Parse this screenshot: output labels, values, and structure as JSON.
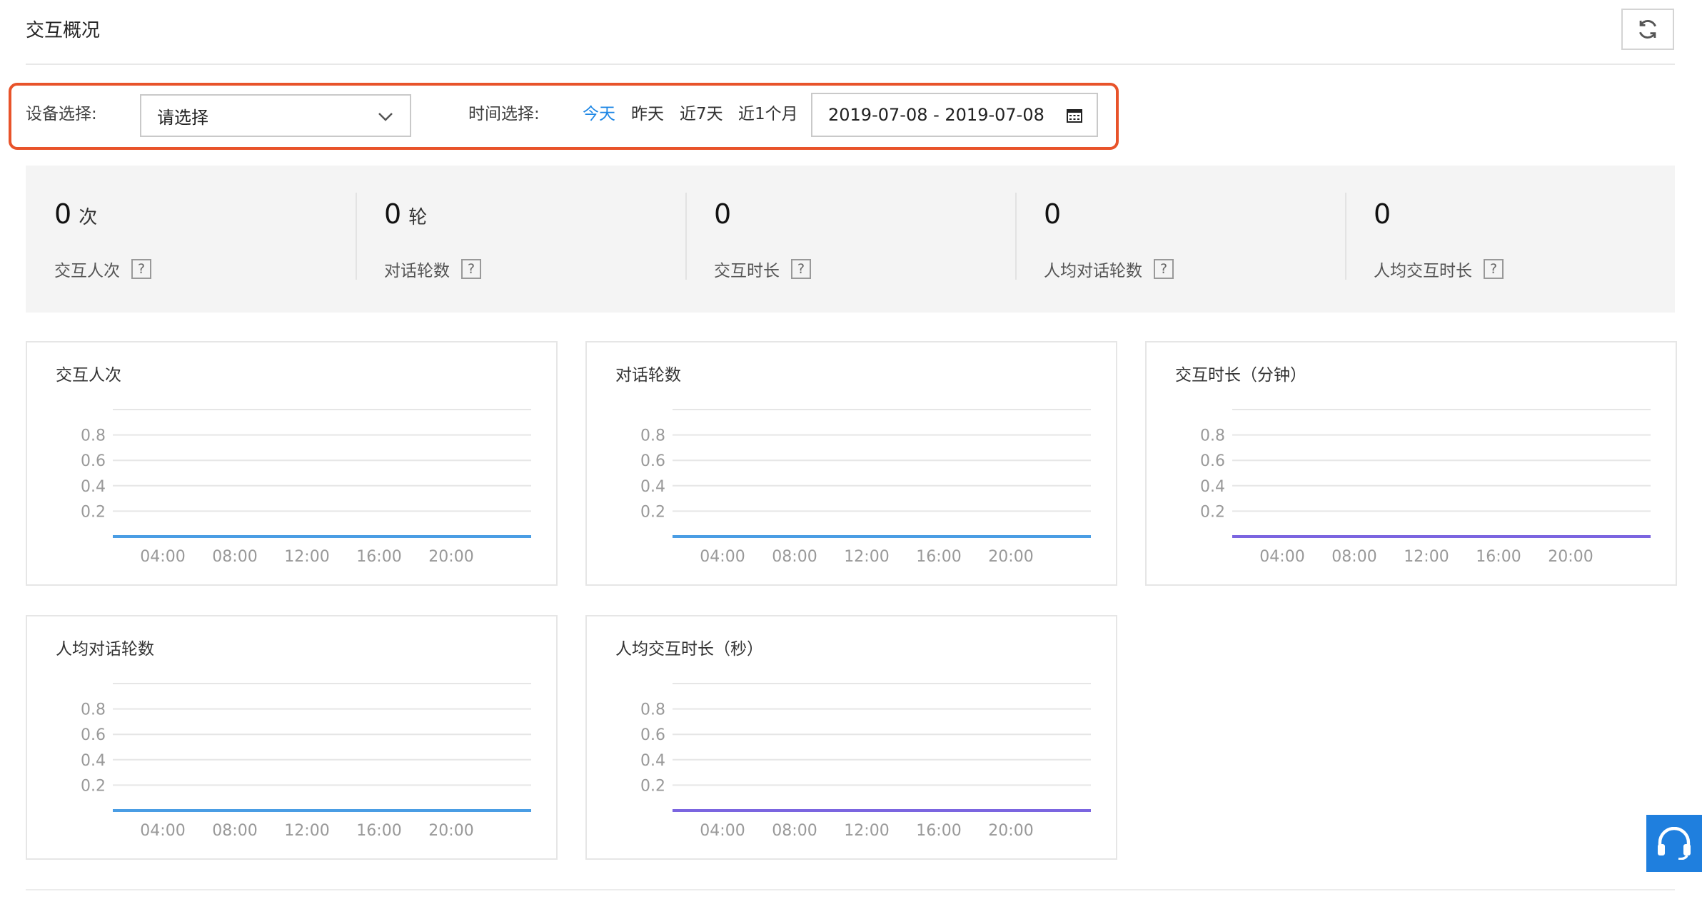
{
  "header": {
    "title": "交互概况"
  },
  "filters": {
    "device_label": "设备选择:",
    "device_value": "请选择",
    "time_label": "时间选择:",
    "time_options": [
      "今天",
      "昨天",
      "近7天",
      "近1个月"
    ],
    "active_time_option": "今天",
    "date_range": "2019-07-08 - 2019-07-08"
  },
  "stats": [
    {
      "value": "0",
      "unit": "次",
      "label": "交互人次"
    },
    {
      "value": "0",
      "unit": "轮",
      "label": "对话轮数"
    },
    {
      "value": "0",
      "unit": "",
      "label": "交互时长"
    },
    {
      "value": "0",
      "unit": "",
      "label": "人均对话轮数"
    },
    {
      "value": "0",
      "unit": "",
      "label": "人均交互时长"
    }
  ],
  "help_mark": "?",
  "colors": {
    "accent": "#1f87e5",
    "blue_line": "#4a9de4",
    "purple_line": "#7b65e0",
    "highlight_border": "#e8532a"
  },
  "icons": {
    "refresh": "refresh-icon",
    "chevron": "chevron-down-icon",
    "calendar": "calendar-icon",
    "support": "headset-icon",
    "help": "help-icon"
  },
  "chart_data": [
    {
      "type": "line",
      "title": "交互人次",
      "x": [
        "04:00",
        "08:00",
        "12:00",
        "16:00",
        "20:00"
      ],
      "y_ticks": [
        0.2,
        0.4,
        0.6,
        0.8
      ],
      "ylim": [
        0,
        1
      ],
      "series": [
        {
          "values": [
            0,
            0,
            0,
            0,
            0
          ],
          "color": "#4a9de4"
        }
      ],
      "grid": true
    },
    {
      "type": "line",
      "title": "对话轮数",
      "x": [
        "04:00",
        "08:00",
        "12:00",
        "16:00",
        "20:00"
      ],
      "y_ticks": [
        0.2,
        0.4,
        0.6,
        0.8
      ],
      "ylim": [
        0,
        1
      ],
      "series": [
        {
          "values": [
            0,
            0,
            0,
            0,
            0
          ],
          "color": "#4a9de4"
        }
      ],
      "grid": true
    },
    {
      "type": "line",
      "title": "交互时长（分钟）",
      "x": [
        "04:00",
        "08:00",
        "12:00",
        "16:00",
        "20:00"
      ],
      "y_ticks": [
        0.2,
        0.4,
        0.6,
        0.8
      ],
      "ylim": [
        0,
        1
      ],
      "series": [
        {
          "values": [
            0,
            0,
            0,
            0,
            0
          ],
          "color": "#7b65e0"
        }
      ],
      "grid": true
    },
    {
      "type": "line",
      "title": "人均对话轮数",
      "x": [
        "04:00",
        "08:00",
        "12:00",
        "16:00",
        "20:00"
      ],
      "y_ticks": [
        0.2,
        0.4,
        0.6,
        0.8
      ],
      "ylim": [
        0,
        1
      ],
      "series": [
        {
          "values": [
            0,
            0,
            0,
            0,
            0
          ],
          "color": "#4a9de4"
        }
      ],
      "grid": true
    },
    {
      "type": "line",
      "title": "人均交互时长（秒）",
      "x": [
        "04:00",
        "08:00",
        "12:00",
        "16:00",
        "20:00"
      ],
      "y_ticks": [
        0.2,
        0.4,
        0.6,
        0.8
      ],
      "ylim": [
        0,
        1
      ],
      "series": [
        {
          "values": [
            0,
            0,
            0,
            0,
            0
          ],
          "color": "#7b65e0"
        }
      ],
      "grid": true
    }
  ]
}
